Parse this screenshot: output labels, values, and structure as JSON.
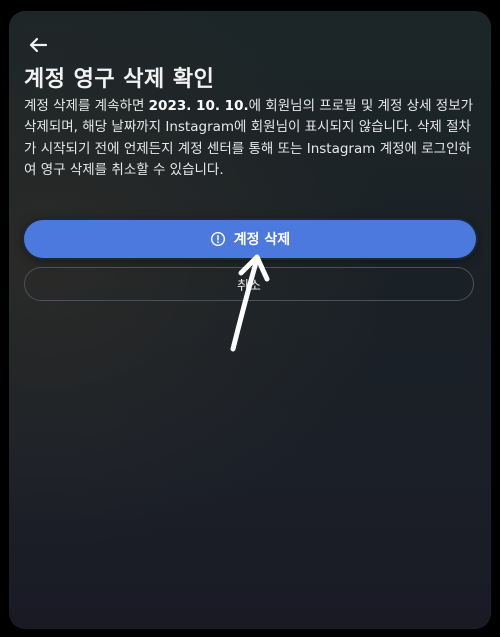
{
  "header": {
    "back_icon": "arrow-left-icon",
    "title": "계정 영구 삭제 확인"
  },
  "message": {
    "before_date": "계정 삭제를 계속하면 ",
    "date": "2023. 10. 10.",
    "after_date": "에 회원님의 프로필 및 계정 상세 정보가 삭제되며, 해당 날짜까지 Instagram에 회원님이 표시되지 않습니다. 삭제 절차가 시작되기 전에 언제든지 계정 센터를 통해 또는 Instagram 계정에 로그인하여 영구 삭제를 취소할 수 있습니다."
  },
  "actions": {
    "delete_label": "계정 삭제",
    "delete_icon": "info-circle-icon",
    "cancel_label": "취소"
  },
  "colors": {
    "primary_button": "#4b79de",
    "background": "#1b2228",
    "text": "#f2f2f2"
  },
  "annotation": {
    "icon": "hand-drawn-arrow-icon"
  }
}
